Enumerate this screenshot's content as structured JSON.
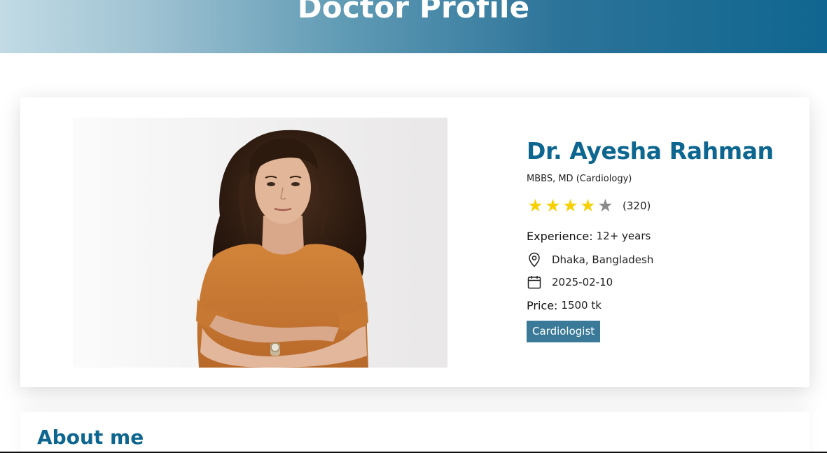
{
  "header": {
    "title": "Doctor Profile"
  },
  "profile": {
    "photo_alt": "doctor-portrait",
    "name": "Dr. Ayesha Rahman",
    "degree": "MBBS, MD (Cardiology)",
    "rating": {
      "value": 4,
      "max": 5,
      "reviews": "(320)"
    },
    "experience_label": "Experience:",
    "experience_value": "12+ years",
    "location": "Dhaka, Bangladesh",
    "date": "2025-02-10",
    "price_label": "Price:",
    "price_value": "1500 tk",
    "specialty": "Cardiologist"
  },
  "about": {
    "title": "About me"
  },
  "colors": {
    "brand": "#0d6690",
    "badge": "#3a7a98",
    "star_on": "#f6d003",
    "star_off": "#8a8a8a"
  },
  "icons": [
    "location-pin-icon",
    "calendar-icon",
    "star-icon"
  ]
}
